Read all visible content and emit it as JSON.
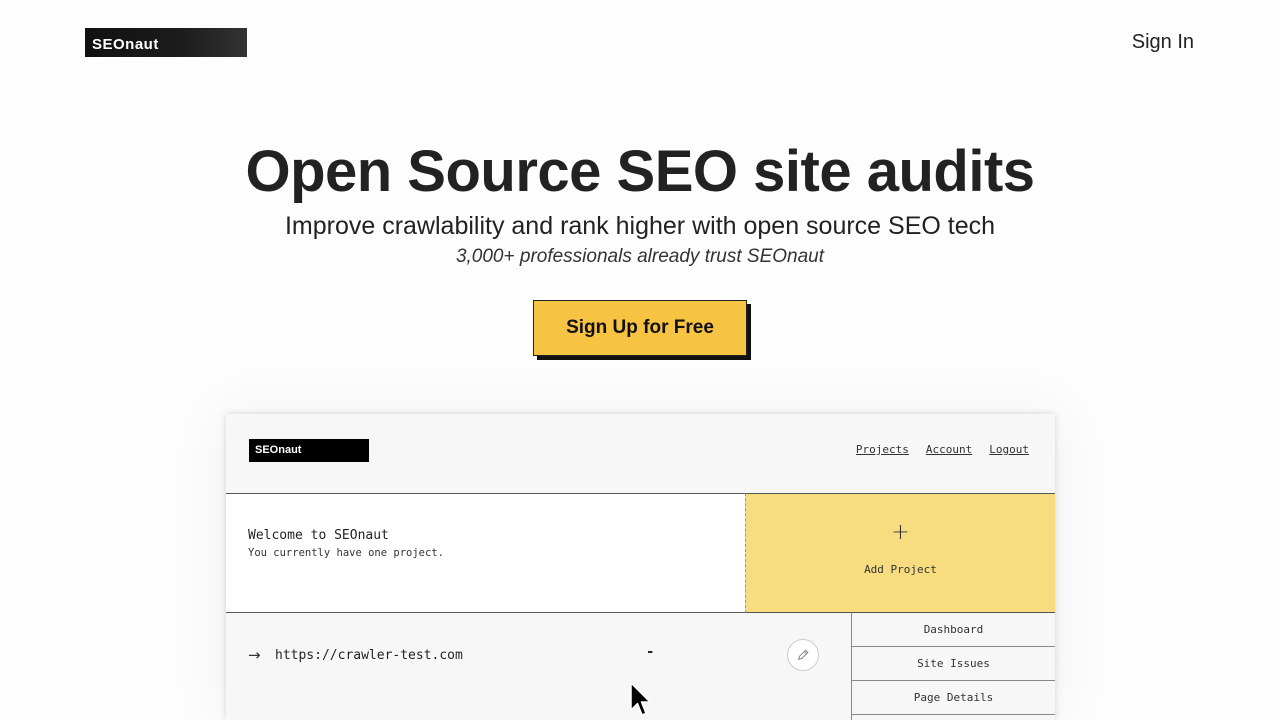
{
  "header": {
    "logo": "SEOnaut",
    "sign_in": "Sign In"
  },
  "hero": {
    "title": "Open Source SEO site audits",
    "subtitle": "Improve crawlability and rank higher with open source SEO tech",
    "trust": "3,000+ professionals already trust SEOnaut",
    "cta": "Sign Up for Free"
  },
  "preview": {
    "logo": "SEOnaut",
    "nav": [
      "Projects",
      "Account",
      "Logout"
    ],
    "welcome_title": "Welcome to SEOnaut",
    "welcome_text": "You currently have one project.",
    "add_project_icon": "+",
    "add_project_label": "Add Project",
    "project": {
      "arrow_icon": "→",
      "url": "https://crawler-test.com",
      "status": "-",
      "edit_icon": "pencil-icon"
    },
    "side_menu": [
      "Dashboard",
      "Site Issues",
      "Page Details"
    ]
  },
  "colors": {
    "cta": "#f7c343",
    "add_project": "#f7dc80"
  }
}
